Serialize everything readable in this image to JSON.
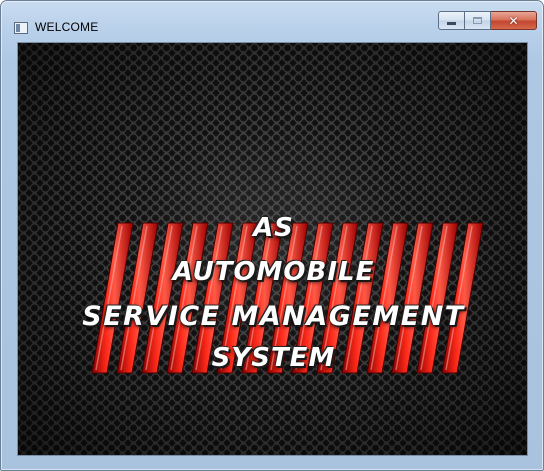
{
  "window": {
    "title": "WELCOME",
    "icons": {
      "app": "app-window-icon",
      "minimize": "minimize-icon",
      "maximize": "maximize-icon",
      "close": "close-icon"
    }
  },
  "splash": {
    "line1": "AS",
    "line2": "AUTOMOBILE",
    "line3": "SERVICE MANAGEMENT",
    "line4": "SYSTEM"
  },
  "colors": {
    "stripe_red": "#e00000",
    "stripe_highlight": "#ff4a3a",
    "background_mesh": "#2b2b2b"
  }
}
